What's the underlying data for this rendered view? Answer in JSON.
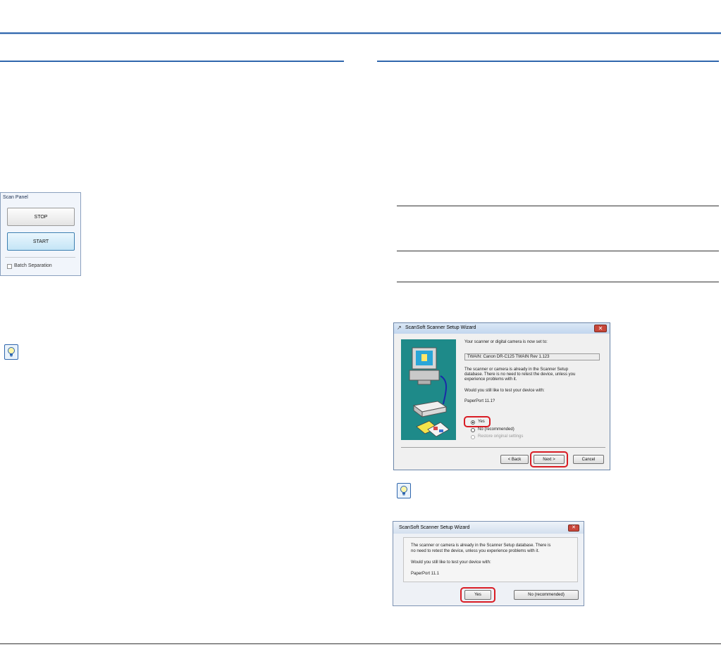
{
  "scan_panel": {
    "title": "Scan Panel",
    "stop_label": "STOP",
    "start_label": "START",
    "batch_label": "Batch Separation",
    "batch_checked": false
  },
  "wizard1": {
    "logo": "↗",
    "title": "ScanSoft Scanner Setup Wizard",
    "close": "✕",
    "set_to_text": "Your scanner or digital camera is now set to:",
    "device_value": "TWAIN: Canon DR-C125 TWAIN Rev 1.123",
    "already_line1": "The scanner or camera is already in the Scanner Setup",
    "already_line2": "database. There is no need to retest the device, unless you",
    "already_line3": "experience problems with it.",
    "question": "Would you still like to test your device with:",
    "app": "PaperPort 11.1?",
    "option_yes": "Yes",
    "option_no": "No (recommended)",
    "option_restore": "Restore original settings",
    "back": "< Back",
    "next": "Next >",
    "cancel": "Cancel"
  },
  "wizard2": {
    "title": "ScanSoft Scanner Setup Wizard",
    "close": "✕",
    "line1": "The scanner or camera is already in the Scanner Setup database. There is",
    "line2": "no need to retest the device, unless you experience problems with it.",
    "question": "Would you still like to test your device with:",
    "app": "PaperPort 11.1",
    "yes": "Yes",
    "no": "No (recommended)"
  },
  "colors": {
    "accent_blue": "#2f66ad",
    "highlight_red": "#d91c24",
    "art_teal": "#1e8a89"
  },
  "icons": [
    "hint-lightbulb-icon",
    "scanner-computer-illustration",
    "close-icon"
  ]
}
